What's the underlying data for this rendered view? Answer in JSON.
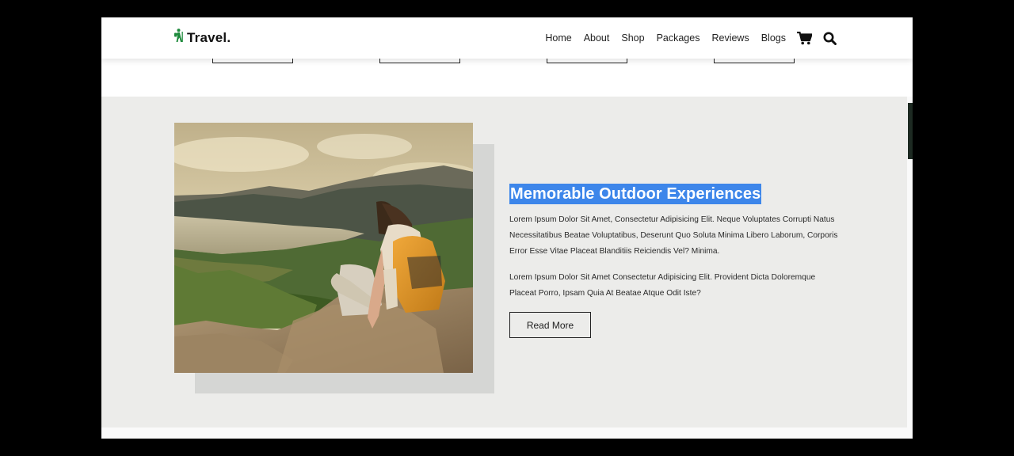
{
  "header": {
    "logo_text": "Travel.",
    "logo_icon": "hiker-icon",
    "brand_color": "#1e8a3c",
    "nav": [
      "Home",
      "About",
      "Shop",
      "Packages",
      "Reviews",
      "Blogs"
    ],
    "icons": [
      "cart-icon",
      "search-icon"
    ]
  },
  "feature": {
    "title": "Memorable Outdoor Experiences",
    "highlight_color": "#3d86ea",
    "paragraph1": "Lorem Ipsum Dolor Sit Amet, Consectetur Adipisicing Elit. Neque Voluptates Corrupti Natus Necessitatibus Beatae Voluptatibus, Deserunt Quo Soluta Minima Libero Laborum, Corporis Error Esse Vitae Placeat Blanditiis Reiciendis Vel? Minima.",
    "paragraph2": "Lorem Ipsum Dolor Sit Amet Consectetur Adipisicing Elit. Provident Dicta Doloremque Placeat Porro, Ipsam Quia At Beatae Atque Odit Iste?",
    "button_label": "Read More",
    "image_alt": "hiker-with-backpack-overlooking-bay"
  }
}
